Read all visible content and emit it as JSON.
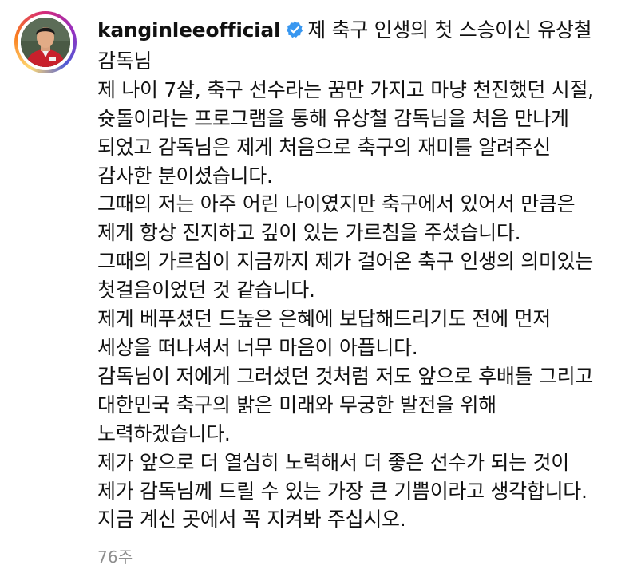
{
  "post": {
    "username": "kanginleeofficial",
    "verified_icon": "verified-badge-icon",
    "accent_color": "#3897f0",
    "caption_title": "제 축구 인생의 첫 스승이신 유상철 감독님",
    "caption_lines": [
      "제 나이 7살, 축구 선수라는 꿈만 가지고 마냥 천진했던 시절, 슛돌이라는 프로그램을 통해 유상철 감독님을 처음 만나게 되었고 감독님은 제게 처음으로 축구의 재미를 알려주신 감사한 분이셨습니다.",
      "그때의 저는 아주 어린 나이였지만 축구에서 있어서 만큼은 제게 항상 진지하고 깊이 있는 가르침을 주셨습니다.",
      "그때의 가르침이 지금까지 제가 걸어온 축구 인생의 의미있는 첫걸음이었던 것 같습니다.",
      "제게 베푸셨던 드높은 은혜에 보답해드리기도 전에 먼저 세상을 떠나셔서 너무 마음이 아픕니다.",
      "감독님이 저에게 그러셨던 것처럼 저도 앞으로 후배들 그리고 대한민국 축구의 밝은 미래와 무궁한 발전을 위해 노력하겠습니다.",
      "제가 앞으로 더 열심히 노력해서 더 좋은 선수가 되는 것이 제가 감독님께 드릴 수 있는 가장 큰 기쁨이라고 생각합니다. 지금 계신 곳에서 꼭 지켜봐 주십시오."
    ],
    "timestamp": "76주"
  }
}
